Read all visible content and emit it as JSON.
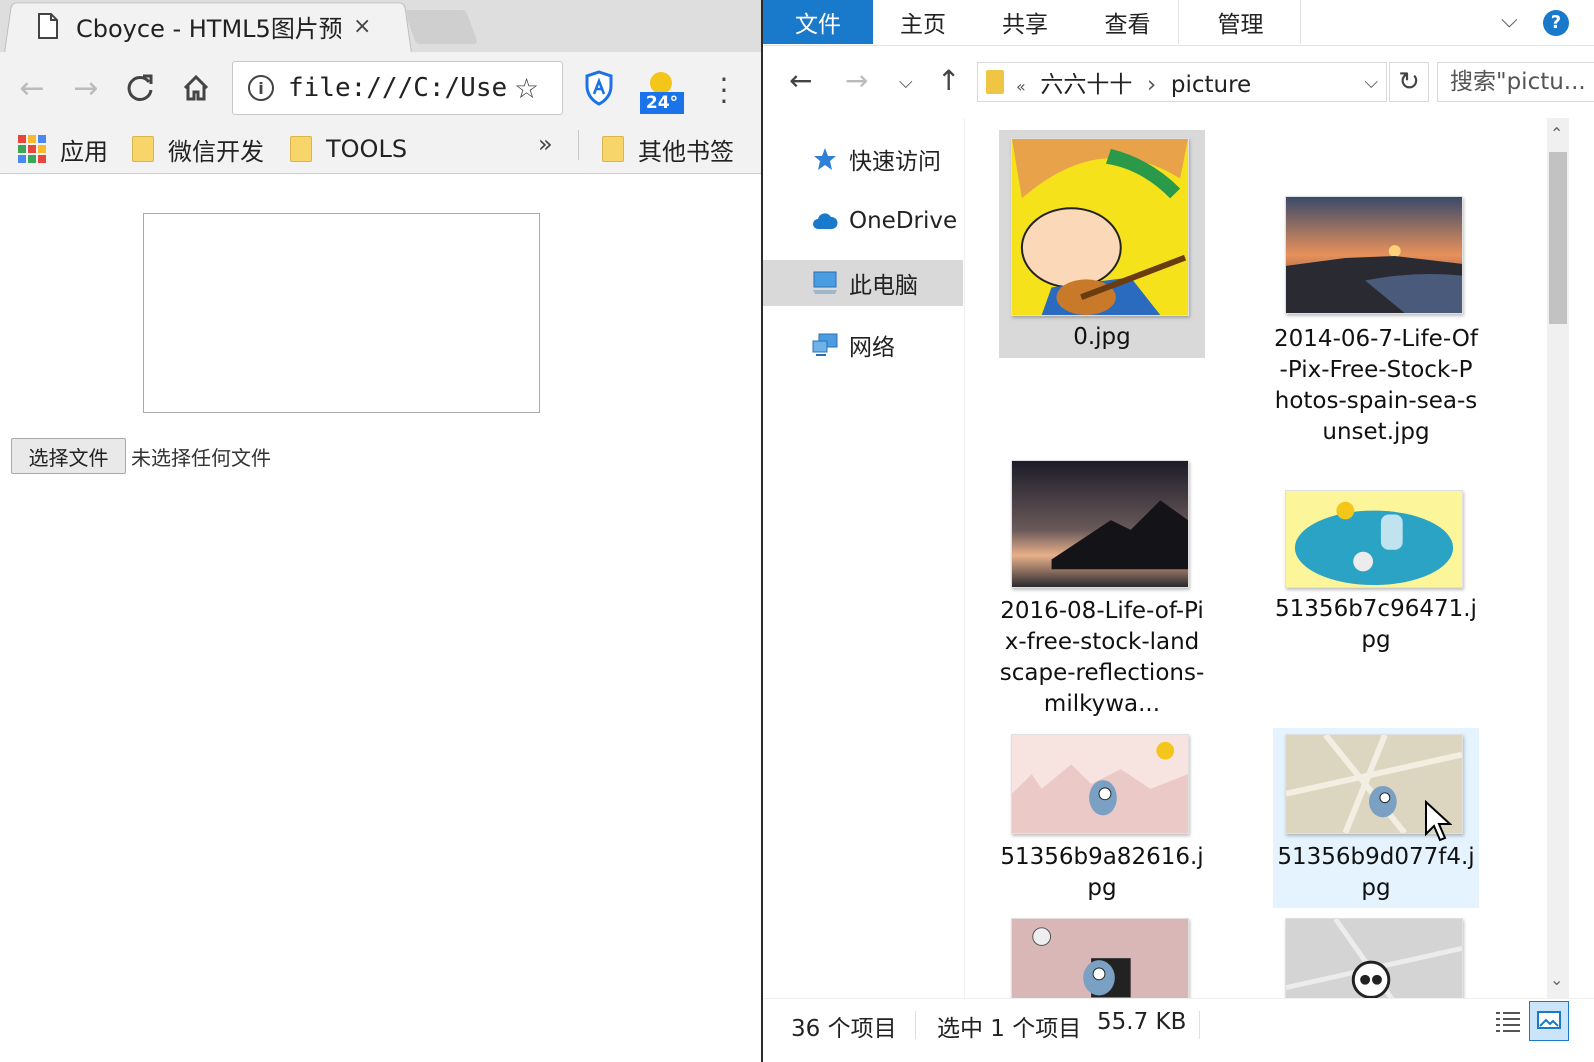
{
  "browser": {
    "tab_title": "Cboyce - HTML5图片预",
    "tab_close": "×",
    "url": "file:///C:/Users/C",
    "weather_temp": "24°",
    "bookmarks": [
      {
        "label": "应用"
      },
      {
        "label": "微信开发"
      },
      {
        "label": "TOOLS"
      },
      {
        "label": "其他书签"
      }
    ],
    "bookmarks_more": "»",
    "file_button": "选择文件",
    "file_status": "未选择任何文件"
  },
  "explorer": {
    "ribbon_tabs": [
      "文件",
      "主页",
      "共享",
      "查看",
      "管理"
    ],
    "help": "?",
    "address_prefix": "«",
    "address_parent": "六六十十",
    "address_sep": "›",
    "address_current": "picture",
    "search_placeholder": "搜索\"pictu...",
    "nav": [
      {
        "label": "快速访问"
      },
      {
        "label": "OneDrive"
      },
      {
        "label": "此电脑"
      },
      {
        "label": "网络"
      }
    ],
    "files": [
      {
        "name": "0.jpg"
      },
      {
        "name": "2014-06-7-Life-Of-Pix-Free-Stock-Photos-spain-sea-sunset.jpg"
      },
      {
        "name": "2016-08-Life-of-Pix-free-stock-landscape-reflections-milkywa..."
      },
      {
        "name": "51356b7c96471.jpg"
      },
      {
        "name": "51356b9a82616.jpg"
      },
      {
        "name": "51356b9d077f4.jpg"
      }
    ],
    "status_count": "36 个项目",
    "status_selected": "选中 1 个项目",
    "status_size": "55.7 KB"
  }
}
